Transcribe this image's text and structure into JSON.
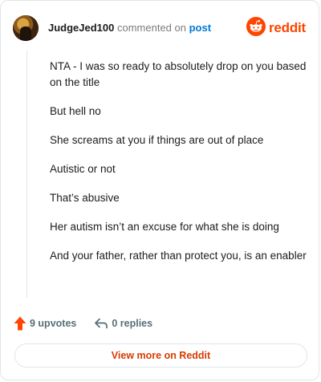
{
  "header": {
    "username": "JudgeJed100",
    "verb": " commented on ",
    "post_link": "post",
    "brand": "reddit"
  },
  "comment": {
    "paragraphs": [
      "NTA - I was so ready to absolutely drop on you based on the title",
      "But hell no",
      "She screams at you if things are out of place",
      "Autistic or not",
      "That’s abusive",
      "Her autism isn’t an excuse for what she is doing",
      "And your father, rather than protect you, is an enabler"
    ]
  },
  "actions": {
    "upvotes": "9 upvotes",
    "replies": "0 replies"
  },
  "footer": {
    "view_more": "View more on Reddit"
  },
  "colors": {
    "brand": "#ff4500",
    "upvote": "#ff4500",
    "link": "#0079d3",
    "view_more_text": "#d93a00"
  },
  "icons": [
    "user-avatar",
    "reddit-snoo-icon",
    "upvote-arrow-icon",
    "reply-arrow-icon"
  ]
}
